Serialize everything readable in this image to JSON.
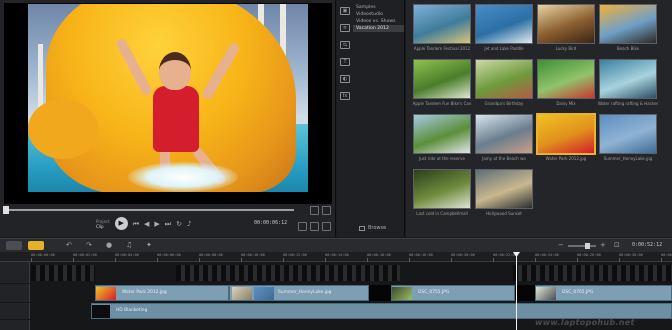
{
  "player": {
    "modes": [
      "Project",
      "Clip"
    ],
    "active_mode": "Clip",
    "timecode": "00:00:06:12"
  },
  "library": {
    "categories": [
      "Samples",
      "Videostudio",
      "Videos vs. Shows",
      "Vacation 2012"
    ],
    "selected_category": "Vacation 2012",
    "browse_label": "Browse",
    "thumbnails": [
      {
        "label": "Apple Tandem Festival 2012",
        "colors": [
          "#7fb0d8",
          "#3f7c9b",
          "#d9c47a"
        ],
        "selected": false
      },
      {
        "label": "Jet and Lake Paddle",
        "colors": [
          "#4a8dc7",
          "#2b6fa5",
          "#e2e9ee"
        ],
        "selected": false
      },
      {
        "label": "Lucky Bird",
        "colors": [
          "#e9d3a1",
          "#8a5d2f",
          "#3b2616"
        ],
        "selected": false
      },
      {
        "label": "Beach Bike",
        "colors": [
          "#f0b03a",
          "#6fa0c8",
          "#2d2a22"
        ],
        "selected": false
      },
      {
        "label": "Apple Tandem Fun Bike's Can",
        "colors": [
          "#8fc14f",
          "#4a7d2a",
          "#dfe6d0"
        ],
        "selected": false
      },
      {
        "label": "Grandpa's Birthday",
        "colors": [
          "#cbd9a6",
          "#6e9a3c",
          "#b45b45"
        ],
        "selected": false
      },
      {
        "label": "Daisy Mix",
        "colors": [
          "#3f8f35",
          "#91c36a",
          "#c9362f"
        ],
        "selected": false
      },
      {
        "label": "Water rafting rafting & Hacker",
        "colors": [
          "#3a7fa0",
          "#a8d3de",
          "#2a4e63"
        ],
        "selected": false
      },
      {
        "label": "Just ride at the reserve",
        "colors": [
          "#a6c9e0",
          "#5b8f3a",
          "#e0e5e8"
        ],
        "selected": false
      },
      {
        "label": "Jamy at the Beach wo",
        "colors": [
          "#d7e4ec",
          "#6a7d8e",
          "#c9a189"
        ],
        "selected": false
      },
      {
        "label": "Water Park 2012.jpg",
        "colors": [
          "#f2c024",
          "#e0901c",
          "#d21d2d"
        ],
        "selected": true
      },
      {
        "label": "Summer_HonnyLake.jpg",
        "colors": [
          "#5d8fc2",
          "#8fb3d4",
          "#3d6c94"
        ],
        "selected": false
      },
      {
        "label": "Last cold in Campbellmall",
        "colors": [
          "#2a3f1c",
          "#6f8c3d",
          "#dfe4d5"
        ],
        "selected": false
      },
      {
        "label": "Hollywood Sunset",
        "colors": [
          "#5e6e78",
          "#c9b88f",
          "#2b2d2f"
        ],
        "selected": false
      }
    ]
  },
  "timeline": {
    "project_time": "0:00:52:12",
    "ruler": [
      "00:00:00:00",
      "00:00:02:00",
      "00:00:04:00",
      "00:00:06:00",
      "00:00:08:00",
      "00:00:10:00",
      "00:00:12:00",
      "00:00:14:00",
      "00:00:16:00",
      "00:00:18:00",
      "00:00:20:00",
      "00:00:22:00",
      "00:00:24:00",
      "00:00:26:00",
      "00:00:28:00",
      "00:00:30:00"
    ],
    "clips": [
      {
        "label": "Water Park 2012.jpg"
      },
      {
        "label": "Summer_HonnyLake.jpg"
      },
      {
        "label": "DSC_0755.JPG"
      },
      {
        "label": "DSC_0765.JPG"
      }
    ],
    "title_track_label": "HD Blanketing",
    "colors": {
      "view_primary": "#e6b12a",
      "clip": "#7d9fb4"
    }
  },
  "watermark": "www.laptopohub.net"
}
